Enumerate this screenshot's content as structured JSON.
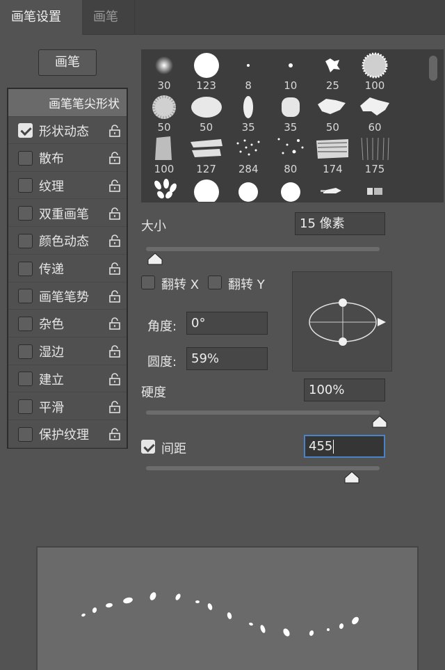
{
  "tabs": [
    {
      "label": "画笔设置",
      "active": true
    },
    {
      "label": "画笔",
      "active": false
    }
  ],
  "brushes_button": "画笔",
  "sidebar": {
    "header": "画笔笔尖形状",
    "items": [
      {
        "label": "形状动态",
        "checked": true
      },
      {
        "label": "散布",
        "checked": false
      },
      {
        "label": "纹理",
        "checked": false
      },
      {
        "label": "双重画笔",
        "checked": false
      },
      {
        "label": "颜色动态",
        "checked": false
      },
      {
        "label": "传递",
        "checked": false
      },
      {
        "label": "画笔笔势",
        "checked": false
      },
      {
        "label": "杂色",
        "checked": false
      },
      {
        "label": "湿边",
        "checked": false
      },
      {
        "label": "建立",
        "checked": false
      },
      {
        "label": "平滑",
        "checked": false
      },
      {
        "label": "保护纹理",
        "checked": false
      }
    ]
  },
  "presets": {
    "row1": [
      "30",
      "123",
      "8",
      "10",
      "25",
      "100"
    ],
    "row2": [
      "50",
      "50",
      "35",
      "35",
      "50",
      "60"
    ],
    "row3": [
      "100",
      "127",
      "284",
      "80",
      "174",
      "175"
    ]
  },
  "size": {
    "label": "大小",
    "value": "15 像素",
    "fraction": 0.04
  },
  "flip_x": {
    "label": "翻转 X",
    "checked": false
  },
  "flip_y": {
    "label": "翻转 Y",
    "checked": false
  },
  "angle": {
    "label": "角度:",
    "value": "0°"
  },
  "roundness": {
    "label": "圆度:",
    "value": "59%"
  },
  "hardness": {
    "label": "硬度",
    "value": "100%",
    "fraction": 1.0
  },
  "spacing": {
    "label": "间距",
    "value": "455",
    "checked": true,
    "fraction": 0.88
  },
  "colors": {
    "background": "#535353",
    "focus": "#4b83c8",
    "panel": "#424242"
  }
}
